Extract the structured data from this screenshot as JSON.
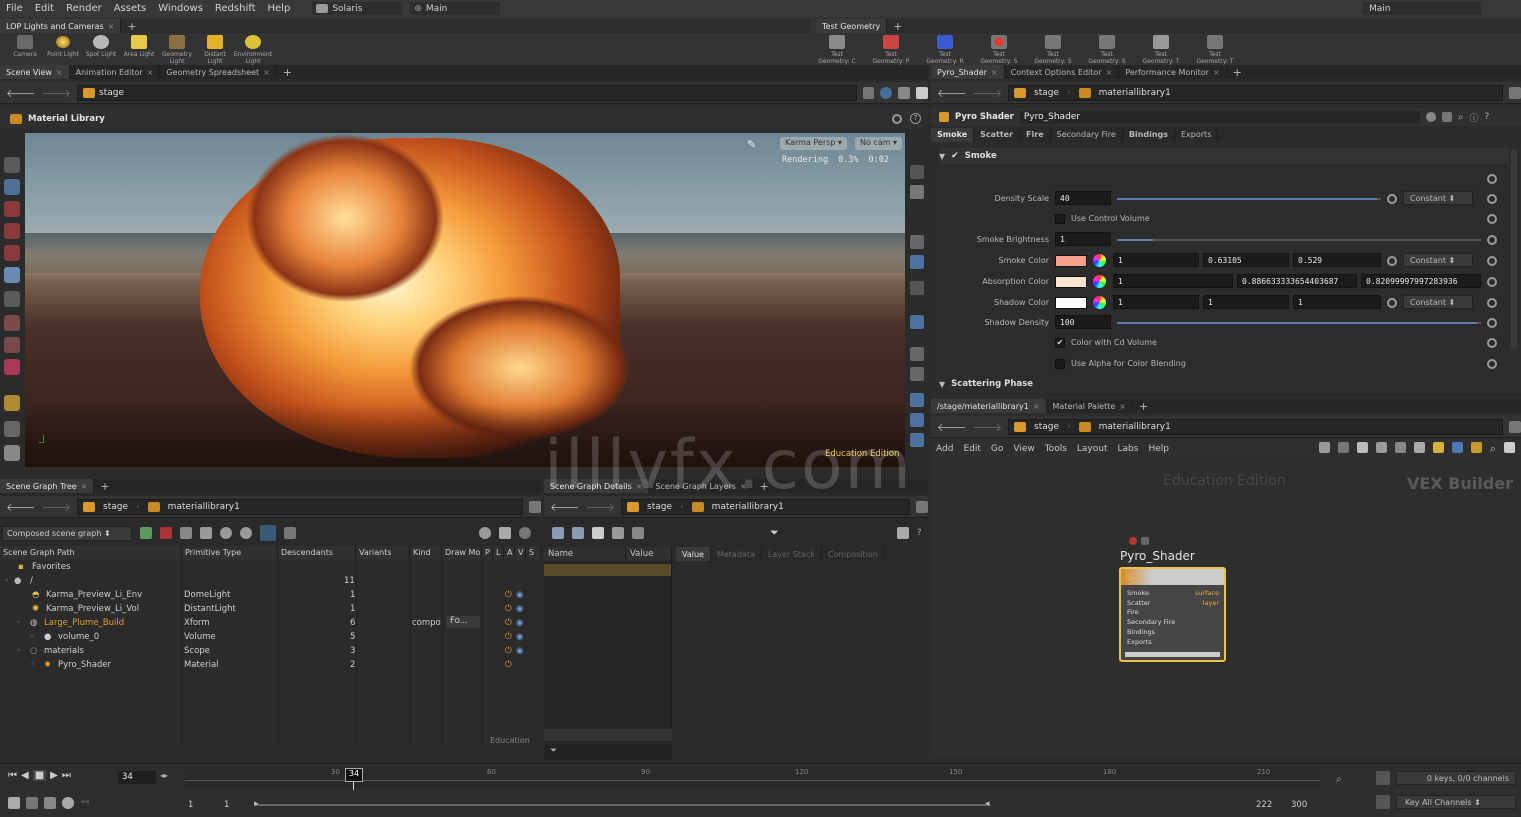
{
  "menu": {
    "items": [
      "File",
      "Edit",
      "Render",
      "Assets",
      "Windows",
      "Redshift",
      "Help"
    ],
    "desktop": "Solaris",
    "workspace": "Main",
    "right_workspace": "Main"
  },
  "shelf_left": {
    "tab": "LOP Lights and Cameras",
    "tools": [
      "Camera",
      "Point Light",
      "Spot Light",
      "Area Light",
      "Geometry Light",
      "Distant Light",
      "Environment Light"
    ]
  },
  "shelf_right": {
    "tab": "Test Geometry",
    "tools": [
      "Test Geometry: C",
      "Test Geometry: P",
      "Test Geometry: R",
      "Test Geometry: S",
      "Test Geometry: S",
      "Test Geometry: S",
      "Test Geometry: T",
      "Test Geometry: T"
    ]
  },
  "viewer": {
    "tabs": [
      "Scene View",
      "Animation Editor",
      "Geometry Spreadsheet"
    ],
    "path": "stage",
    "header": "Material Library",
    "renderer": "Karma Persp",
    "camera": "No cam",
    "status": "Rendering",
    "progress": "0.3%",
    "time": "0:02",
    "watermark": "Education Edition"
  },
  "params": {
    "tabs": [
      "Pyro_Shader",
      "Context Options Editor",
      "Performance Monitor"
    ],
    "path": "stage",
    "node": "materiallibrary1",
    "type": "Pyro Shader",
    "name": "Pyro_Shader",
    "subtabs": [
      "Smoke",
      "Scatter",
      "Fire",
      "Secondary Fire",
      "Bindings",
      "Exports"
    ],
    "section": "Smoke",
    "section2": "Scattering Phase",
    "density_scale_label": "Density Scale",
    "density_scale": "40",
    "constant": "Constant",
    "use_control_volume": "Use Control Volume",
    "smoke_brightness_label": "Smoke Brightness",
    "smoke_brightness": "1",
    "smoke_color_label": "Smoke Color",
    "smoke_color": [
      "1",
      "0.63105",
      "0.529"
    ],
    "smoke_color_hex": "#f4a088",
    "absorption_color_label": "Absorption Color",
    "absorption_color": [
      "1",
      "0.886633333654403687",
      "0.82099997997283936"
    ],
    "absorption_color_hex": "#fde2d2",
    "shadow_color_label": "Shadow Color",
    "shadow_color": [
      "1",
      "1",
      "1"
    ],
    "shadow_color_hex": "#ffffff",
    "shadow_density_label": "Shadow Density",
    "shadow_density": "100",
    "color_cd": "Color with Cd Volume",
    "use_alpha": "Use Alpha for Color Blending"
  },
  "network": {
    "tabs": [
      "/stage/materiallibrary1",
      "Material Palette"
    ],
    "path": "stage",
    "node": "materiallibrary1",
    "menu": [
      "Add",
      "Edit",
      "Go",
      "View",
      "Tools",
      "Layout",
      "Labs",
      "Help"
    ],
    "watermark": "Education Edition",
    "context": "VEX Builder",
    "node_name": "Pyro_Shader",
    "inputs": [
      "Smoke",
      "Scatter",
      "Fire",
      "Secondary Fire",
      "Bindings",
      "Exports"
    ],
    "outputs": [
      "surface",
      "layer"
    ]
  },
  "scene_graph": {
    "tab": "Scene Graph Tree",
    "path": "stage",
    "node": "materiallibrary1",
    "mode": "Composed scene graph",
    "columns": [
      "Scene Graph Path",
      "Primitive Type",
      "Descendants",
      "Variants",
      "Kind",
      "Draw Mo",
      "P",
      "L",
      "A",
      "V",
      "S"
    ],
    "rows": [
      {
        "path": "Favorites",
        "type": "",
        "desc": "",
        "kind": "",
        "indent": 1
      },
      {
        "path": "/",
        "type": "",
        "desc": "11",
        "kind": "",
        "indent": 0
      },
      {
        "path": "Karma_Preview_Li_Env",
        "type": "DomeLight",
        "desc": "1",
        "kind": "",
        "indent": 2
      },
      {
        "path": "Karma_Preview_Li_Vol",
        "type": "DistantLight",
        "desc": "1",
        "kind": "",
        "indent": 2
      },
      {
        "path": "Large_Plume_Build",
        "type": "Xform",
        "desc": "6",
        "kind": "compo",
        "draw": "Fo...",
        "indent": 2,
        "highlight": true
      },
      {
        "path": "volume_0",
        "type": "Volume",
        "desc": "5",
        "kind": "",
        "indent": 3
      },
      {
        "path": "materials",
        "type": "Scope",
        "desc": "3",
        "kind": "",
        "indent": 2
      },
      {
        "path": "Pyro_Shader",
        "type": "Material",
        "desc": "2",
        "kind": "",
        "indent": 3
      }
    ],
    "footer": "Education"
  },
  "details": {
    "tabs": [
      "Scene Graph Details",
      "Scene Graph Layers"
    ],
    "path": "stage",
    "node": "materiallibrary1",
    "cols": [
      "Name",
      "Value"
    ],
    "subtabs": [
      "Value",
      "Metadata",
      "Layer Stack",
      "Composition"
    ]
  },
  "timeline": {
    "frame": "34",
    "marker": "34",
    "ticks": [
      "30",
      "60",
      "90",
      "120",
      "150",
      "180",
      "210"
    ],
    "start": "1",
    "start2": "1",
    "end": "222",
    "end2": "300",
    "keys": "0 keys, 0/0 channels",
    "key_all": "Key All Channels"
  },
  "site_watermark": "illlvfx.com"
}
